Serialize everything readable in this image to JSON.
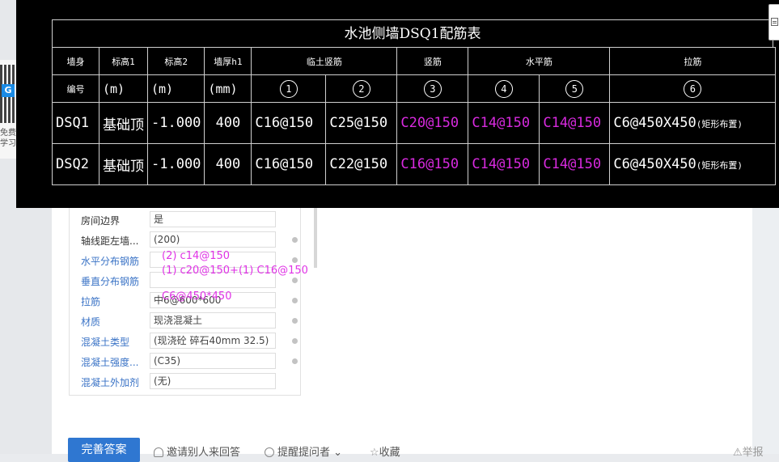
{
  "left_promo": {
    "badge": "G",
    "text_line1": "免费",
    "text_line2": "学习"
  },
  "cad_table": {
    "title": "水池侧墙DSQ1配筋表",
    "header": {
      "wall_no_line1": "墙身",
      "wall_no_line2": "编号",
      "elev1": "标高1",
      "elev2": "标高2",
      "thickness": "墙厚h1",
      "vert_bar": "临土竖筋",
      "vert_bar2": "竖筋",
      "horiz_bar": "水平筋",
      "tie_bar": "拉筋"
    },
    "units": {
      "elev1": "(m)",
      "elev2": "(m)",
      "thickness": "(mm)"
    },
    "circles": [
      "1",
      "2",
      "3",
      "4",
      "5",
      "6"
    ],
    "rows": [
      {
        "id": "DSQ1",
        "elev1": "基础顶",
        "elev2": "-1.000",
        "thickness": "400",
        "c1": "C16@150",
        "c2": "C25@150",
        "c3": "C20@150",
        "c4": "C14@150",
        "c5": "C14@150",
        "c6": "C6@450X450",
        "c6_note": "(矩形布置)"
      },
      {
        "id": "DSQ2",
        "elev1": "基础顶",
        "elev2": "-1.000",
        "thickness": "400",
        "c1": "C16@150",
        "c2": "C22@150",
        "c3": "C16@150",
        "c4": "C14@150",
        "c5": "C14@150",
        "c6": "C6@450X450",
        "c6_note": "(矩形布置)"
      }
    ]
  },
  "form": {
    "rows": [
      {
        "label": "房间边界",
        "value": "是"
      },
      {
        "label": "轴线距左墙...",
        "value": "(200)"
      },
      {
        "label": "水平分布钢筋",
        "value": ""
      },
      {
        "label": "垂直分布钢筋",
        "value": ""
      },
      {
        "label": "拉筋",
        "value": "中6@600*600"
      },
      {
        "label": "材质",
        "value": "现浇混凝土"
      },
      {
        "label": "混凝土类型",
        "value": "(现浇砼 碎石40mm 32.5)"
      },
      {
        "label": "混凝土强度...",
        "value": "(C35)"
      },
      {
        "label": "混凝土外加剂",
        "value": "(无)"
      }
    ]
  },
  "overlays": {
    "horiz": "(2) c14@150",
    "vert": "(1) c20@150+(1) C16@150",
    "tie": "C6@450*450"
  },
  "actions": {
    "answer": "完善答案",
    "invite": "邀请别人来回答",
    "remind": "提醒提问者",
    "collect": "收藏",
    "report": "举报"
  },
  "colors": {
    "magenta": "#d82adf",
    "accent": "#2f77d1",
    "label_blue": "#3a73c6"
  }
}
